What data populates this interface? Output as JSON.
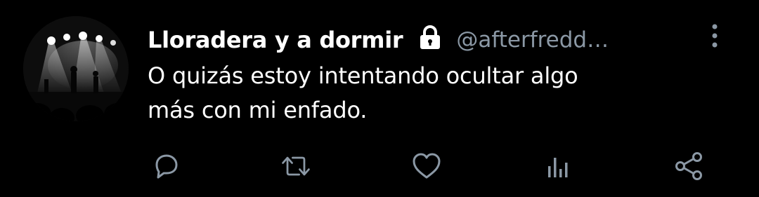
{
  "tweet": {
    "display_name": "Lloradera y a dormir",
    "handle": "@afterfredd…",
    "protected": true,
    "text_lines": [
      "O quizás estoy intentando ocultar algo",
      "más con mi enfado."
    ]
  },
  "icons": {
    "avatar": "concert-stage-photo",
    "protected": "lock-icon",
    "more": "vertical-ellipsis-icon",
    "actions": [
      "reply-icon",
      "retweet-icon",
      "like-icon",
      "analytics-icon",
      "share-icon"
    ]
  },
  "colors": {
    "background": "#000000",
    "text": "#ffffff",
    "secondary": "#8b98a5"
  }
}
